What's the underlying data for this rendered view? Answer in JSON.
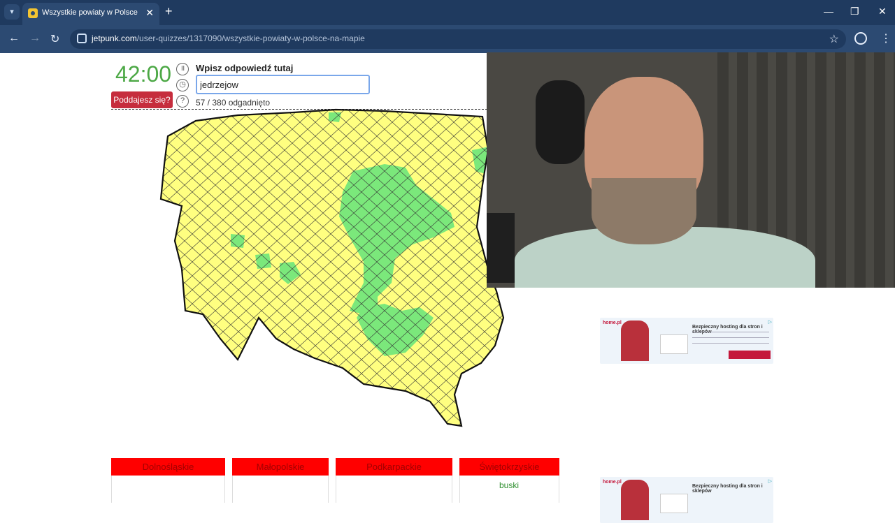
{
  "browser": {
    "tab_title": "Wszystkie powiaty w Polsce na",
    "tab_close": "✕",
    "new_tab": "+",
    "url_host": "jetpunk.com",
    "url_path": "/user-quizzes/1317090/wszystkie-powiaty-w-polsce-na-mapie"
  },
  "quiz": {
    "timer": "42:00",
    "give_up": "Poddajesz się?",
    "prompt": "Wpisz odpowiedź tutaj",
    "answer_value": "jedrzejow",
    "progress": "57 / 380 odgadnięto"
  },
  "map": {
    "colors": {
      "unguessed": "#ffff80",
      "guessed": "#7be87b",
      "border": "#111111"
    }
  },
  "regions": [
    {
      "name": "Dolnośląskie"
    },
    {
      "name": "Małopolskie"
    },
    {
      "name": "Podkarpackie"
    },
    {
      "name": "Świętokrzyskie",
      "answers": [
        "buski"
      ]
    }
  ],
  "ads": {
    "brand": "home.pl",
    "headline": "Bezpieczny hosting dla stron i sklepów"
  }
}
